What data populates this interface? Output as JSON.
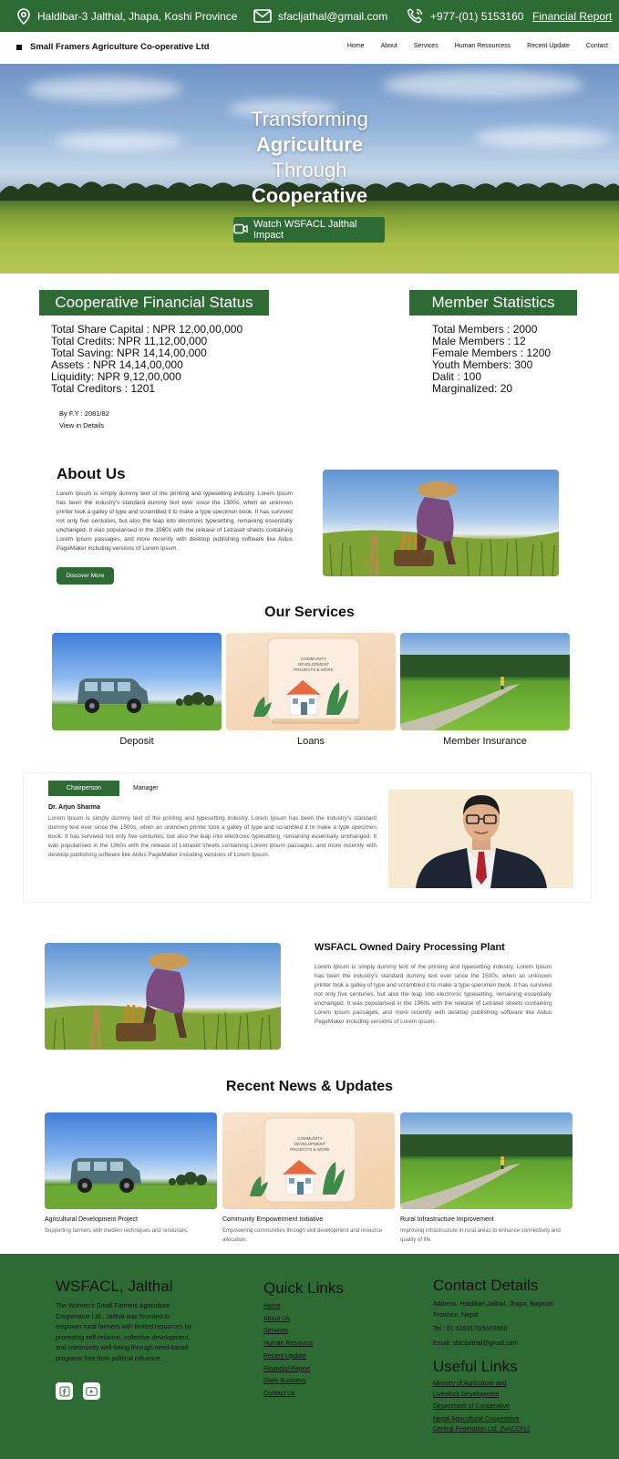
{
  "topbar": {
    "address": "Haldibar-3 Jalthal, Jhapa, Koshi Province",
    "email": "sfacljathal@gmail.com",
    "phone": "+977-(01) 5153160",
    "financial_report": "Financial Report"
  },
  "nav": {
    "brand": "Small Framers Agriculture Co-operative Ltd",
    "items": [
      "Home",
      "About",
      "Services",
      "Human Resourcess",
      "Recent Update",
      "Contact"
    ]
  },
  "hero": {
    "line1": "Transforming",
    "line2": "Agriculture",
    "line3": "Through",
    "line4": "Cooperative",
    "watch_label": "Watch WSFACL Jalthal Impact"
  },
  "financial": {
    "title": "Cooperative Financial Status",
    "lines": [
      "Total Share Capital : NPR 12,00,00,000",
      "Total Credits: NPR 11,12,00,000",
      "Total Saving: NPR 14,14,00,000",
      "Assets : NPR 14,14,00,000",
      "Liquidity: NPR 9,12,00,000",
      "Total Creditors : 1201"
    ],
    "fy": "By F.Y : 2081/82",
    "view_details": "View  in Details"
  },
  "members": {
    "title": "Member Statistics",
    "lines": [
      "Total Members : 2000",
      "Male Members : 12",
      "Female Members : 1200",
      "Youth Members: 300",
      "Dalit : 100",
      "Marginalized: 20"
    ]
  },
  "about": {
    "title": "About Us",
    "body": "Lorem Ipsum is simply dummy text of the printing and typesetting industry. Lorem Ipsum has been the industry's standard dummy text ever since the 1500s, when an unknown printer took a galley of type and scrambled it to make a type specimen book. It has survived not only five centuries, but also the leap into electronic typesetting, remaining essentially unchanged. It was popularised in the 1960s with the release of Letraset sheets containing Lorem Ipsum passages, and more recently with desktop publishing software like Aldus PageMaker including versions of Lorem Ipsum.",
    "button": "Discover More"
  },
  "services": {
    "title": "Our Services",
    "items": [
      {
        "label": "Deposit",
        "image": "vintage-car-field"
      },
      {
        "label": "Loans",
        "image": "community-house-card"
      },
      {
        "label": "Member Insurance",
        "image": "farm-road"
      }
    ],
    "card_caption": [
      "COMMUNITY",
      "DEVELOPMENT",
      "PROJECTS & WORK"
    ]
  },
  "chair": {
    "tabs": [
      "Chairperson",
      "Manager"
    ],
    "name": "Dr. Arjun Sharma",
    "body": "Lorem Ipsum is simply dummy text of the printing and typesetting industry. Lorem Ipsum has been the industry's standard dummy text ever since the 1500s, when an unknown printer took a galley of type and scrambled it to make a type specimen book. It has survived not only five centuries, but also the leap into electronic typesetting, remaining essentially unchanged. It was popularised in the 1960s with the release of Letraset sheets containing Lorem Ipsum passages, and more recently with desktop publishing software like Aldus PageMaker including versions of Lorem Ipsum."
  },
  "dairy": {
    "title": "WSFACL Owned Dairy Processing Plant",
    "body": "Lorem Ipsum is simply dummy text of the printing and typesetting industry. Lorem Ipsum has been the industry's standard dummy text ever since the 1500s, when an unknown printer took a galley of type and scrambled it to make a type specimen book. It has survived not only five centuries, but also the leap into electronic typesetting, remaining essentially unchanged. It was popularised in the 1960s with the release of Letraset sheets containing Lorem Ipsum passages, and more recently with desktop publishing software like Aldus PageMaker including versions of Lorem Ipsum."
  },
  "news": {
    "title": "Recent News & Updates",
    "items": [
      {
        "head": "Agricultural Development Project",
        "sub": "Supporting farmers with modern techniques and resources."
      },
      {
        "head": "Community Empowerment Initiative",
        "sub": "Empowering communities through skill development and resource allocation."
      },
      {
        "head": "Rural Infrastructure Improvement",
        "sub": "Improving infrastructure in rural areas to enhance connectivity and quality of life."
      }
    ]
  },
  "footer": {
    "brand": "WSFACL, Jalthal",
    "desc": "The Women's Small Farmers Agriculture Cooperative Ltd., Jalthal was founded to empower rural farmers with limited resources by promoting self-reliance, collective development, and community well-being through need-based programs free from political influence.",
    "quick_title": "Quick Links",
    "quick_links": [
      "Home",
      "About Us",
      "Services",
      "Human Resource",
      "Recent Update",
      "Financial Report",
      "Dairy Business",
      "Contact Us"
    ],
    "contact_title": "Contact Details",
    "contact": {
      "address": "Address: Haldibari,Jalthal, Jhapa, Bagmati Province, Nepal",
      "tel": "Tel : 01-5153170/5163660",
      "email": "Email: sfacljalthal@gmail.com"
    },
    "useful_title": "Useful Links",
    "useful_links": [
      "Ministry of Agriculture and Livestock Development",
      "Department of Cooperative",
      "Nepal Agricultural Cooperative Central Federation Ltd. (NACCFL)"
    ],
    "social_icons": [
      "facebook-icon",
      "youtube-icon"
    ]
  },
  "colors": {
    "brand_green": "#2e6b34",
    "white": "#ffffff"
  }
}
